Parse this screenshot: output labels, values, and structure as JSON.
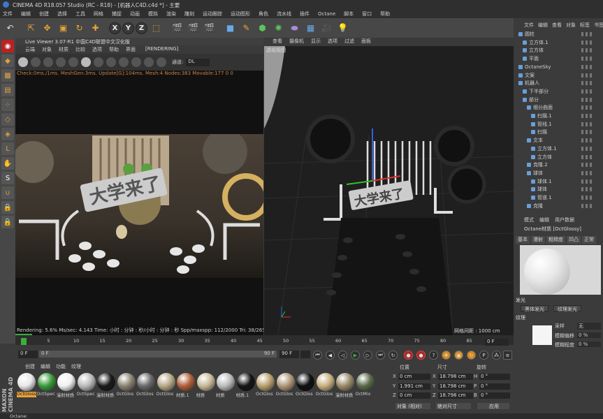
{
  "window": {
    "title": "CINEMA 4D R18.057 Studio (RC - R18) - [机器人C4D.c4d *] - 主要"
  },
  "menubar": [
    "文件",
    "编辑",
    "创建",
    "选择",
    "工具",
    "网格",
    "捕捉",
    "动画",
    "模拟",
    "渲染",
    "雕刻",
    "运动跟踪",
    "运动图形",
    "角色",
    "流水线",
    "插件",
    "Octane",
    "脚本",
    "窗口",
    "帮助"
  ],
  "toolbar": {
    "undo": "↶",
    "xyz": [
      "X",
      "Y",
      "Z"
    ]
  },
  "live_viewer": {
    "title": "Live Viewer 3.07-R1 中国C4D联盟中文汉化版",
    "menu": [
      "云端",
      "对象",
      "材质",
      "比较",
      "选项",
      "帮助",
      "界面"
    ],
    "status_tag": "[RENDERING]",
    "channel_label": "通道:",
    "channel_value": "DL",
    "info": "Check:0ms./1ms. MeshGen:3ms. Update[G]:104ms. Mesh:4 Nodes:383 Movable:177 0 0",
    "stats": "Rendering: 5.6%       Ms/sec: 4.143     Time: 小时 : 分钟 : 秒/小时 : 分钟 : 秒     Spp/maxspp: 112/2000     Tri: 38/265k     Mesh: 177  Hair"
  },
  "viewport": {
    "menu": [
      "查看",
      "摄像机",
      "显示",
      "选项",
      "过滤",
      "面板"
    ],
    "label": "透视视图",
    "footer": "网格间距 : 1000 cm"
  },
  "object_manager": {
    "menu": [
      "文件",
      "编辑",
      "查看",
      "对象",
      "标签",
      "书签"
    ],
    "items": [
      "圆柱",
      "立方体.1",
      "立方体",
      "平面",
      "OctaneSky",
      "文案",
      "机器人",
      "下半部分",
      "部分",
      "细分曲面",
      "扫描.1",
      "管线.1",
      "扫描",
      "文本",
      "立方体.1",
      "立方体",
      "克隆.2",
      "球体",
      "球体.1",
      "球体",
      "管道.1",
      "克隆"
    ]
  },
  "attr": {
    "tabs": [
      "模式",
      "编辑",
      "用户数据"
    ],
    "name": "Octane材质 [OctGlossy]",
    "subtabs": [
      "基本",
      "漫射",
      "粗糙度",
      "凹凸",
      "正常"
    ],
    "emission_label": "发光",
    "btn_blackbody": "黑体发光",
    "btn_texture": "纹理发光",
    "texture_label": "纹理",
    "texture_value": "无",
    "params": [
      {
        "label": "采样",
        "value": ""
      },
      {
        "label": "模糊偏移",
        "value": "0 %"
      },
      {
        "label": "模糊程度",
        "value": "0 %"
      }
    ]
  },
  "timeline": {
    "ticks": [
      "0",
      "5",
      "10",
      "15",
      "20",
      "25",
      "30",
      "35",
      "40",
      "45",
      "50",
      "55",
      "60",
      "65",
      "70",
      "75",
      "80",
      "85",
      "90"
    ],
    "frame_end": "0 F",
    "start": "0 F",
    "slider_start": "0 F",
    "slider_end": "90 F",
    "end_field": "90 F",
    "end_field2": "90 F"
  },
  "material_manager": {
    "menu": [
      "创建",
      "编辑",
      "功能",
      "纹理"
    ],
    "materials": [
      {
        "label": "OctGloss",
        "color": "#e8e8e8",
        "sel": true
      },
      {
        "label": "OctSpec",
        "color": "#3a9a3a"
      },
      {
        "label": "漫射材质",
        "color": "#f0f0f0"
      },
      {
        "label": "OctSpec",
        "color": "#bbbbbb"
      },
      {
        "label": "漫射材质",
        "color": "#1a1a1a"
      },
      {
        "label": "OctGlos",
        "color": "#8a8372"
      },
      {
        "label": "OctGlos",
        "color": "#6a6a6a"
      },
      {
        "label": "OctGlos",
        "color": "#b8a888"
      },
      {
        "label": "材质.1",
        "color": "#b0603a"
      },
      {
        "label": "材质",
        "color": "#c8b898"
      },
      {
        "label": "材质",
        "color": "#bbbbbb"
      },
      {
        "label": "材质.1",
        "color": "#151515"
      },
      {
        "label": "OctGlos",
        "color": "#b8a070"
      },
      {
        "label": "OctGlos",
        "color": "#b09878"
      },
      {
        "label": "OctGlos",
        "color": "#101010"
      },
      {
        "label": "OctGlos",
        "color": "#c8b080"
      },
      {
        "label": "漫射材质",
        "color": "#9a8a6a"
      },
      {
        "label": "OctMix",
        "color": "#5a6a4a"
      }
    ]
  },
  "coordinates": {
    "headers": [
      "位置",
      "尺寸",
      "旋转"
    ],
    "rows": [
      {
        "axis": "X",
        "pos": "0 cm",
        "size_axis": "X",
        "size": "18.798 cm",
        "rot_axis": "H",
        "rot": "0 °"
      },
      {
        "axis": "Y",
        "pos": "1.991 cm",
        "size_axis": "Y",
        "size": "18.798 cm",
        "rot_axis": "P",
        "rot": "0 °"
      },
      {
        "axis": "Z",
        "pos": "0 cm",
        "size_axis": "Z",
        "size": "18.798 cm",
        "rot_axis": "B",
        "rot": "0 °"
      }
    ],
    "mode1": "对象 (相对)",
    "mode2": "绝对尺寸",
    "apply": "应用"
  },
  "status": "Octane:",
  "brand": "MAXON CINEMA 4D",
  "colors": {
    "accent": "#e8a33a",
    "bg": "#3b3b3b"
  }
}
